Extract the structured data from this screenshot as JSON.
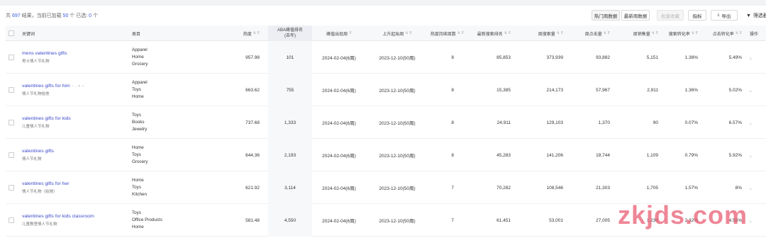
{
  "summary": {
    "prefix": "共",
    "total": "697",
    "mid": "结果，当前已加载",
    "loaded": "50",
    "mid2": "个  已选:",
    "selected": "0",
    "suffix": "个"
  },
  "toolbar": {
    "hot_week": "热门周数据",
    "new_week": "最新周数据",
    "batch_fav": "批量收藏",
    "metrics": "指标",
    "export": "导出",
    "filter": "筛选器"
  },
  "headers": {
    "keyword": "关键词",
    "category": "类目",
    "heat": "热度",
    "aba_rank_line1": "ABA峰值排名",
    "aba_rank_line2": "(去年)",
    "peak_date": "峰值出现周",
    "rise_start": "上升起始周",
    "heat_weeks": "热度持续周数",
    "latest_rank": "最新搜索排名",
    "week_search": "周搜索量",
    "week_click": "周点击量",
    "week_sales": "周销售量",
    "search_conv": "搜索转化率",
    "click_conv": "点击转化率",
    "action": "操作"
  },
  "rows": [
    {
      "keyword": "mens valentines gifts",
      "sub": "男士情人节礼物",
      "cats": [
        "Apparel",
        "Home",
        "Grocery"
      ],
      "heat": "957.98",
      "aba": "101",
      "peak": "2024-02-04(6周)",
      "rise": "2023-12-10(50周)",
      "weeks": "8",
      "rank": "85,853",
      "search": "373,939",
      "click": "93,882",
      "sales": "5,151",
      "sconv": "1.38%",
      "cconv": "5.49%",
      "icons": false
    },
    {
      "keyword": "valentines gifts for him",
      "sub": "情人节礼物给他",
      "cats": [
        "Apparel",
        "Toys",
        "Home"
      ],
      "heat": "663.62",
      "aba": "755",
      "peak": "2024-02-04(6周)",
      "rise": "2023-12-10(50周)",
      "weeks": "8",
      "rank": "15,385",
      "search": "214,173",
      "click": "57,967",
      "sales": "2,911",
      "sconv": "1.36%",
      "cconv": "5.02%",
      "icons": true
    },
    {
      "keyword": "valentines gifts for kids",
      "sub": "儿童情人节礼物",
      "cats": [
        "Toys",
        "Books",
        "Jewelry"
      ],
      "heat": "737.68",
      "aba": "1,333",
      "peak": "2024-02-04(6周)",
      "rise": "2023-12-10(50周)",
      "weeks": "8",
      "rank": "24,911",
      "search": "129,103",
      "click": "1,370",
      "sales": "90",
      "sconv": "0.07%",
      "cconv": "6.57%",
      "icons": false
    },
    {
      "keyword": "valentines gifts",
      "sub": "情人节礼物",
      "cats": [
        "Home",
        "Toys",
        "Grocery"
      ],
      "heat": "644.36",
      "aba": "2,193",
      "peak": "2024-02-04(6周)",
      "rise": "2023-12-10(50周)",
      "weeks": "8",
      "rank": "45,283",
      "search": "141,206",
      "click": "18,744",
      "sales": "1,109",
      "sconv": "0.79%",
      "cconv": "5.92%",
      "icons": false
    },
    {
      "keyword": "valentines gifts for her",
      "sub": "情人节礼物（给她）",
      "cats": [
        "Home",
        "Toys",
        "Kitchen"
      ],
      "heat": "621.92",
      "aba": "3,114",
      "peak": "2024-02-04(6周)",
      "rise": "2023-12-10(50周)",
      "weeks": "7",
      "rank": "70,282",
      "search": "108,546",
      "click": "21,303",
      "sales": "1,705",
      "sconv": "1.57%",
      "cconv": "8%",
      "icons": false
    },
    {
      "keyword": "valentines gifts for kids classroom",
      "sub": "儿童教室情人节礼物",
      "cats": [
        "Toys",
        "Office Products",
        "Home"
      ],
      "heat": "581.48",
      "aba": "4,550",
      "peak": "2024-02-04(6周)",
      "rise": "2023-12-10(50周)",
      "weeks": "7",
      "rank": "61,451",
      "search": "53,001",
      "click": "27,005",
      "sales": "1,230",
      "sconv": "2.32%",
      "cconv": "4.55%",
      "icons": false
    }
  ],
  "watermark": "zkjds.com",
  "colors": {
    "link": "#3b49c9",
    "header_bg": "#f7f8fa",
    "watermark": "#e8586e"
  }
}
